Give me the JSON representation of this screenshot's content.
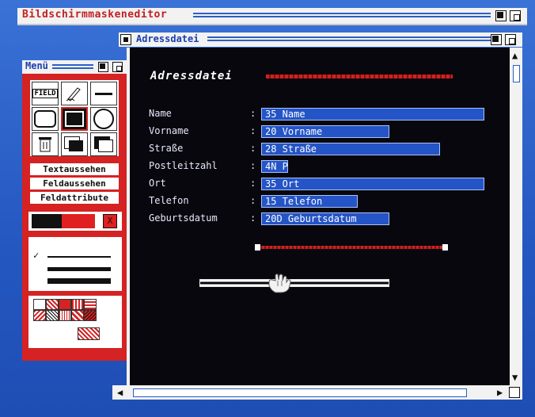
{
  "app": {
    "title": "Bildschirmmaskeneditor"
  },
  "window": {
    "title": "Adressdatei"
  },
  "form": {
    "title": "Adressdatei",
    "fields": [
      {
        "label": "Name",
        "value": "35 Name"
      },
      {
        "label": "Vorname",
        "value": "20 Vorname"
      },
      {
        "label": "Straße",
        "value": "28 Straße"
      },
      {
        "label": "Postleitzahl",
        "value": "4N P"
      },
      {
        "label": "Ort",
        "value": "35 Ort"
      },
      {
        "label": "Telefon",
        "value": "15 Telefon"
      },
      {
        "label": "Geburtsdatum",
        "value": "20D Geburtsdatum"
      }
    ]
  },
  "menu": {
    "title": "Menü",
    "tools": [
      "field-tool",
      "pen-tool",
      "line-tool",
      "rounded-rect-tool",
      "rect-tool",
      "circle-tool",
      "trash-tool",
      "fill-tool",
      "window-tool"
    ],
    "field_icon_label": "FIELD",
    "buttons": [
      "Textaussehen",
      "Feldaussehen",
      "Feldattribute"
    ],
    "color_close": "X",
    "check": "✓"
  },
  "colors": {
    "accent": "#d52222",
    "field": "#2454c6",
    "background": "#2a5fc4",
    "window": "#07070d"
  }
}
